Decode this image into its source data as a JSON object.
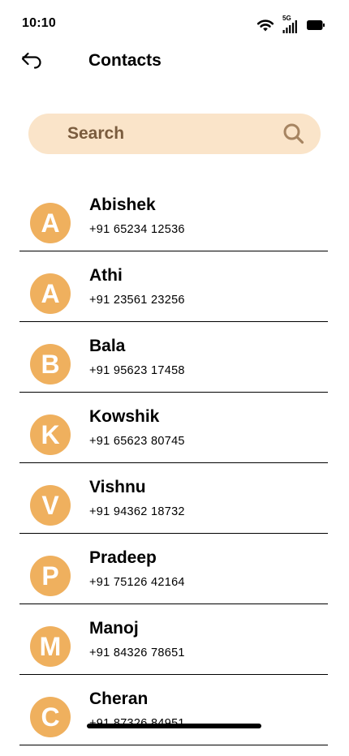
{
  "status_bar": {
    "time": "10:10",
    "network_label": "5G",
    "icons": [
      "wifi-icon",
      "signal-icon",
      "battery-icon"
    ]
  },
  "header": {
    "title": "Contacts",
    "back_icon": "back-arrow-icon"
  },
  "search": {
    "placeholder": "Search",
    "value": "",
    "icon": "search-icon"
  },
  "contacts": [
    {
      "initial": "A",
      "name": "Abishek",
      "phone": "+91 65234 12536"
    },
    {
      "initial": "A",
      "name": "Athi",
      "phone": "+91 23561 23256"
    },
    {
      "initial": "B",
      "name": "Bala",
      "phone": "+91 95623 17458"
    },
    {
      "initial": "K",
      "name": "Kowshik",
      "phone": "+91 65623 80745"
    },
    {
      "initial": "V",
      "name": "Vishnu",
      "phone": "+91 94362 18732"
    },
    {
      "initial": "P",
      "name": "Pradeep",
      "phone": "+91 75126 42164"
    },
    {
      "initial": "M",
      "name": "Manoj",
      "phone": "+91 84326 78651"
    },
    {
      "initial": "C",
      "name": "Cheran",
      "phone": "+91 87326 84951"
    }
  ],
  "colors": {
    "avatar": "#efb05e",
    "search_background": "#fae4c9",
    "search_text": "#7a5c3e",
    "search_icon": "#a68461",
    "text": "#000000",
    "background": "#ffffff"
  }
}
